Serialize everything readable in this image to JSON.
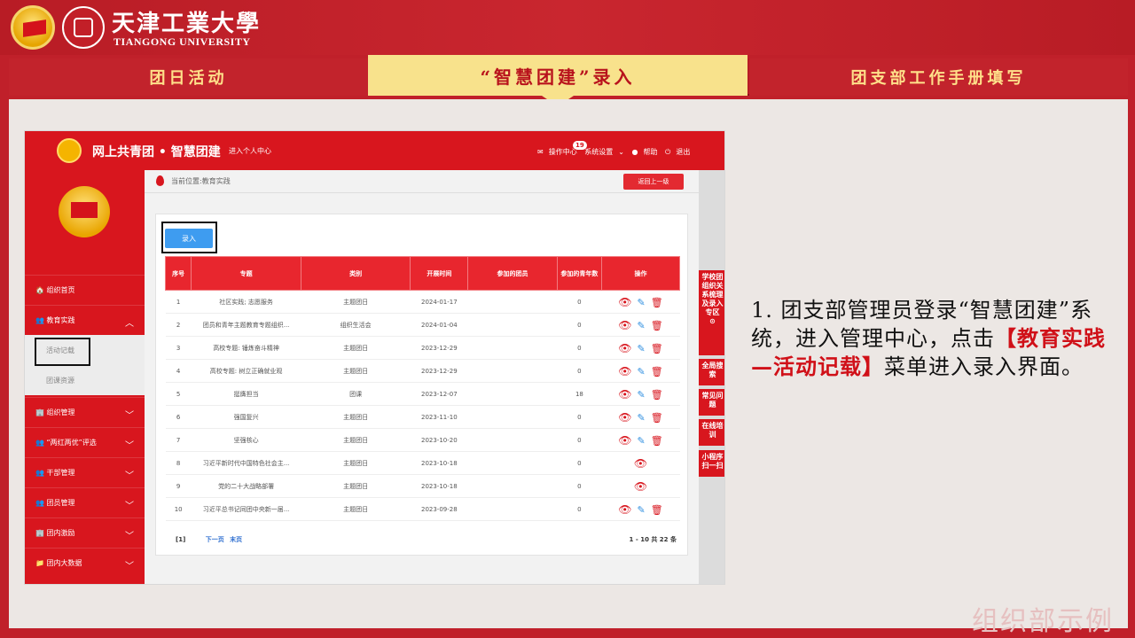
{
  "header": {
    "university_cn": "天津工業大學",
    "university_en": "TIANGONG UNIVERSITY"
  },
  "tabs": [
    {
      "label": "团日活动"
    },
    {
      "label": "“智慧团建”录入"
    },
    {
      "label": "团支部工作手册填写"
    }
  ],
  "app": {
    "site_title": "网上共青团 • 智慧团建",
    "personal_center": "进入个人中心",
    "ops_center": "操作中心",
    "ops_badge": "19",
    "settings": "系统设置",
    "help": "帮助",
    "logout": "退出",
    "breadcrumb": "当前位置:教育实践",
    "back_button": "返回上一级",
    "add_button": "录入"
  },
  "sidebar": {
    "items": [
      {
        "label": "组织首页"
      },
      {
        "label": "教育实践"
      },
      {
        "label": "活动记载"
      },
      {
        "label": "团课资源"
      },
      {
        "label": "组织管理"
      },
      {
        "label": "“两红两优”评选"
      },
      {
        "label": "干部管理"
      },
      {
        "label": "团员管理"
      },
      {
        "label": "团内激励"
      },
      {
        "label": "团内大数据"
      }
    ]
  },
  "right_rail": [
    "学校团组织关系梳理及录入专区",
    "全局搜索",
    "常见问题",
    "在线培训",
    "小程序扫一扫"
  ],
  "table": {
    "headers": [
      "序号",
      "专题",
      "类别",
      "开展时间",
      "参加的团员",
      "参加的青年数",
      "操作"
    ],
    "rows": [
      {
        "no": "1",
        "topic": "社区实践; 志愿服务",
        "cat": "主题团日",
        "date": "2024-01-17",
        "members": "",
        "youth": "0",
        "ops": "full"
      },
      {
        "no": "2",
        "topic": "团员和青年主题教育专题组织...",
        "cat": "组织生活会",
        "date": "2024-01-04",
        "members": "",
        "youth": "0",
        "ops": "full"
      },
      {
        "no": "3",
        "topic": "高校专题: 锤炼奋斗精神",
        "cat": "主题团日",
        "date": "2023-12-29",
        "members": "",
        "youth": "0",
        "ops": "full"
      },
      {
        "no": "4",
        "topic": "高校专题: 树立正确就业观",
        "cat": "主题团日",
        "date": "2023-12-29",
        "members": "",
        "youth": "0",
        "ops": "full"
      },
      {
        "no": "5",
        "topic": "挺膺担当",
        "cat": "团课",
        "date": "2023-12-07",
        "members": "",
        "youth": "18",
        "ops": "full"
      },
      {
        "no": "6",
        "topic": "强国复兴",
        "cat": "主题团日",
        "date": "2023-11-10",
        "members": "",
        "youth": "0",
        "ops": "full"
      },
      {
        "no": "7",
        "topic": "坚强核心",
        "cat": "主题团日",
        "date": "2023-10-20",
        "members": "",
        "youth": "0",
        "ops": "full"
      },
      {
        "no": "8",
        "topic": "习近平新时代中国特色社会主...",
        "cat": "主题团日",
        "date": "2023-10-18",
        "members": "",
        "youth": "0",
        "ops": "view"
      },
      {
        "no": "9",
        "topic": "党的二十大战略部署",
        "cat": "主题团日",
        "date": "2023-10-18",
        "members": "",
        "youth": "0",
        "ops": "view"
      },
      {
        "no": "10",
        "topic": "习近平总书记同团中央新一届...",
        "cat": "主题团日",
        "date": "2023-09-28",
        "members": "",
        "youth": "0",
        "ops": "full"
      }
    ],
    "pager_current": "[1]",
    "pager_next": "下一页",
    "pager_last": "末页",
    "total": "1 - 10 共 22 条"
  },
  "description": {
    "line1": "1. 团支部管理员登录“智慧团建”系统，进入管理中心，点击",
    "highlight": "【教育实践—活动记载】",
    "line2": "菜单进入录入界面。"
  },
  "footer_note": "组织部示例",
  "colors": {
    "primary_red": "#d8161e",
    "tab_gold": "#f8e28c",
    "button_blue": "#3e9cf0"
  }
}
